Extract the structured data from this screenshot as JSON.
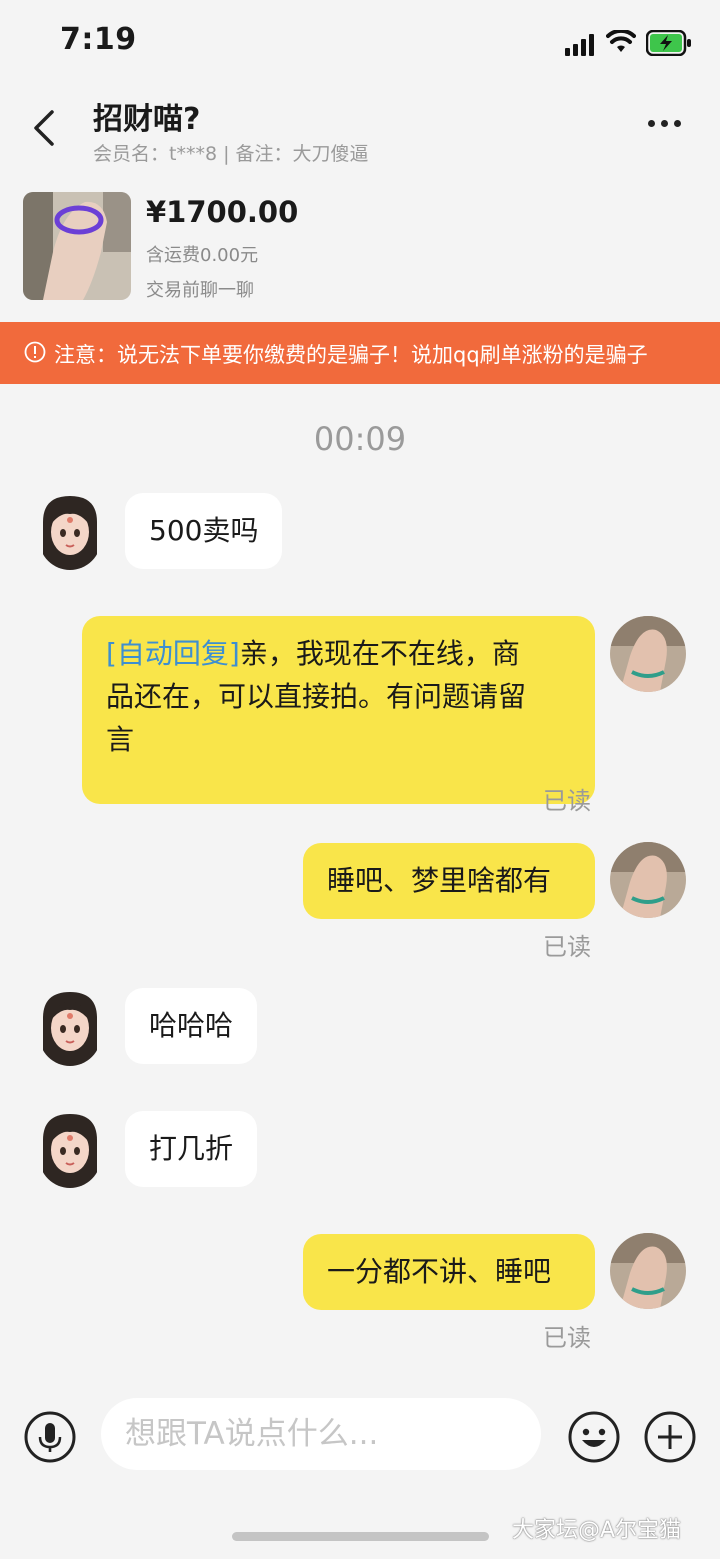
{
  "status_bar": {
    "time": "7:19"
  },
  "header": {
    "title": "招财喵?",
    "member_info": "会员名：t***8 | 备注：大刀傻逼"
  },
  "product": {
    "price": "¥1700.00",
    "shipping": "含运费0.00元",
    "note": "交易前聊一聊"
  },
  "warning": {
    "text": "注意：说无法下单要你缴费的是骗子！说加qq刷单涨粉的是骗子"
  },
  "chat": {
    "timestamp": "00:09",
    "messages": [
      {
        "side": "in",
        "text": "500卖吗"
      },
      {
        "side": "out",
        "tag": "[自动回复]",
        "lines": [
          "亲，我现在不在线，商",
          "品还在，可以直接拍。有问题请留",
          "言"
        ],
        "status": "已读"
      },
      {
        "side": "out",
        "text": "睡吧、梦里啥都有",
        "status": "已读"
      },
      {
        "side": "in",
        "text": "哈哈哈"
      },
      {
        "side": "in",
        "text": "打几折"
      },
      {
        "side": "out",
        "text": "一分都不讲、睡吧",
        "status": "已读"
      }
    ]
  },
  "input": {
    "placeholder": "想跟TA说点什么..."
  },
  "watermark": "大家坛@A尔宝猫",
  "colors": {
    "accent_yellow": "#f9e54a",
    "warning_orange": "#f16a3c",
    "auto_reply_blue": "#3d8fd1"
  }
}
